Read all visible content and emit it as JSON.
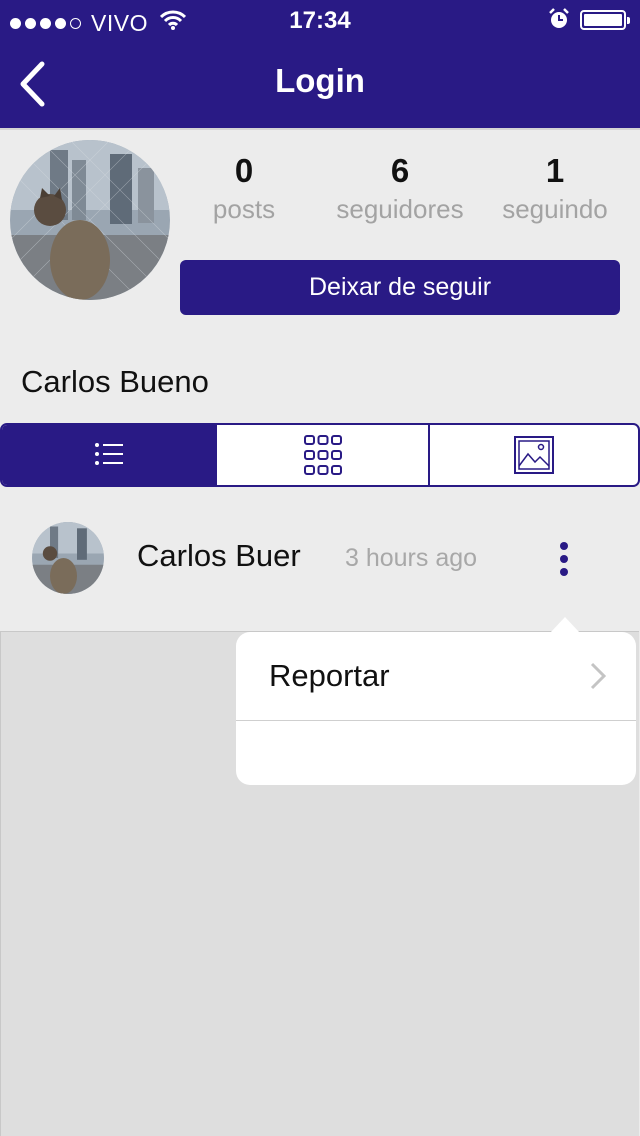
{
  "status_bar": {
    "carrier": "VIVO",
    "time": "17:34",
    "signal_bars_filled": 4,
    "signal_bars_total": 5,
    "battery_level": 1.0
  },
  "nav": {
    "title": "Login",
    "back_icon": "chevron-left-icon"
  },
  "profile": {
    "stats": [
      {
        "value": "0",
        "label": "posts"
      },
      {
        "value": "6",
        "label": "seguidores"
      },
      {
        "value": "1",
        "label": "seguindo"
      }
    ],
    "follow_button": "Deixar de seguir",
    "name": "Carlos Bueno"
  },
  "view_tabs": [
    {
      "icon": "list-icon",
      "active": true
    },
    {
      "icon": "grid-icon",
      "active": false
    },
    {
      "icon": "image-icon",
      "active": false
    }
  ],
  "post": {
    "author": "Carlos Buer",
    "time": "3 hours ago"
  },
  "popover": {
    "items": [
      {
        "label": "Reportar"
      }
    ]
  },
  "colors": {
    "brand": "#291a85",
    "background": "#ececec",
    "muted_text": "#a3a3a3"
  }
}
